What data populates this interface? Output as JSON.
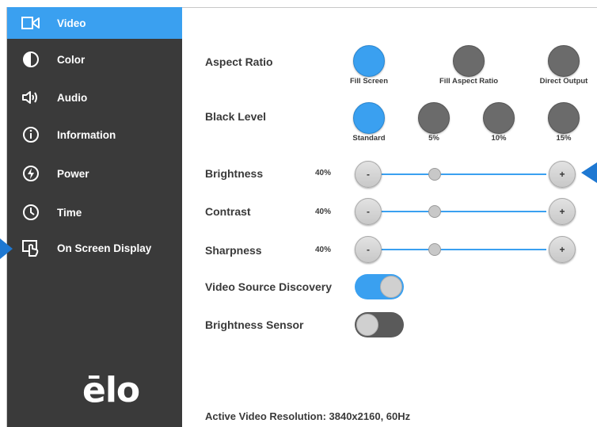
{
  "sidebar": {
    "items": [
      {
        "label": "Video",
        "icon": "video-camera-icon",
        "active": true
      },
      {
        "label": "Color",
        "icon": "contrast-icon"
      },
      {
        "label": "Audio",
        "icon": "speaker-icon"
      },
      {
        "label": "Information",
        "icon": "info-icon"
      },
      {
        "label": "Power",
        "icon": "power-icon"
      },
      {
        "label": "Time",
        "icon": "clock-icon"
      },
      {
        "label": "On Screen Display",
        "icon": "osd-touch-icon"
      }
    ],
    "logo": "ēlo"
  },
  "aspect_ratio": {
    "label": "Aspect Ratio",
    "options": [
      "Fill Screen",
      "Fill Aspect Ratio",
      "Direct Output"
    ],
    "selected": "Fill Screen"
  },
  "black_level": {
    "label": "Black Level",
    "options": [
      "Standard",
      "5%",
      "10%",
      "15%"
    ],
    "selected": "Standard"
  },
  "sliders": [
    {
      "label": "Brightness",
      "value": "40%",
      "level": 0.4
    },
    {
      "label": "Contrast",
      "value": "40%",
      "level": 0.4
    },
    {
      "label": "Sharpness",
      "value": "40%",
      "level": 0.4
    }
  ],
  "slider_controls": {
    "minus": "-",
    "plus": "+"
  },
  "toggles": {
    "video_source_discovery": {
      "label": "Video Source Discovery",
      "state": "on"
    },
    "brightness_sensor": {
      "label": "Brightness Sensor",
      "state": "off"
    }
  },
  "footer": {
    "text": "Active Video Resolution: 3840x2160, 60Hz"
  },
  "colors": {
    "accent": "#3aa0f0",
    "sidebar_bg": "#3a3a3a",
    "pointer": "#1e78d2"
  }
}
